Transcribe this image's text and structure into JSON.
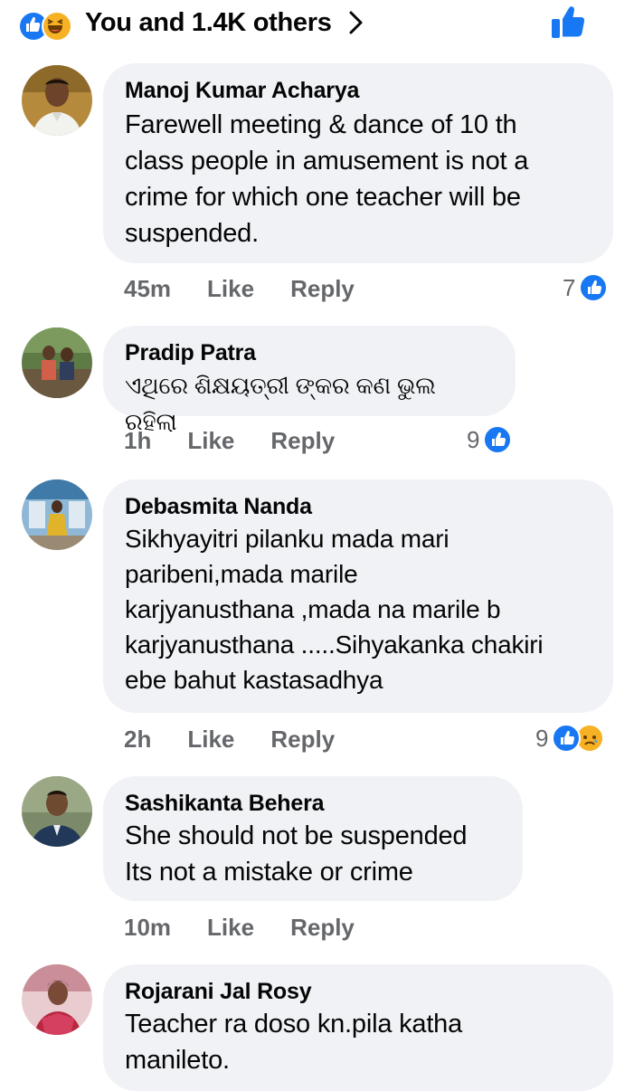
{
  "reactions_summary": {
    "text": "You and 1.4K others",
    "icons": [
      "like-icon",
      "haha-icon"
    ],
    "accent_color": "#1877f2"
  },
  "comments": [
    {
      "author": "Manoj Kumar Acharya",
      "text": "Farewell meeting & dance of 10 th\nclass people in amusement is not a\ncrime for which one teacher will be\nsuspended.",
      "time": "45m",
      "like_label": "Like",
      "reply_label": "Reply",
      "reaction_count": "7",
      "reactions": [
        "like-icon"
      ]
    },
    {
      "author": "Pradip Patra",
      "text": "ଏଥିରେ ଶିକ୍ଷୟତ୍ରୀ ଙ୍କର କଣ ଭୁଲ ରହିଲା",
      "time": "1h",
      "like_label": "Like",
      "reply_label": "Reply",
      "reaction_count": "9",
      "reactions": [
        "like-icon"
      ]
    },
    {
      "author": "Debasmita Nanda",
      "text": "Sikhyayitri pilanku mada mari\nparibeni,mada marile\nkarjyanusthana ,mada na marile b\nkarjyanusthana .....Sihyakanka chakiri\nebe bahut kastasadhya",
      "time": "2h",
      "like_label": "Like",
      "reply_label": "Reply",
      "reaction_count": "9",
      "reactions": [
        "like-icon",
        "sad-icon"
      ]
    },
    {
      "author": "Sashikanta Behera",
      "text": "She should not be suspended\nIts not a mistake or crime",
      "time": "10m",
      "like_label": "Like",
      "reply_label": "Reply"
    },
    {
      "author": "Rojarani Jal Rosy",
      "text": "Teacher ra doso kn.pila katha\nmanileto."
    }
  ]
}
